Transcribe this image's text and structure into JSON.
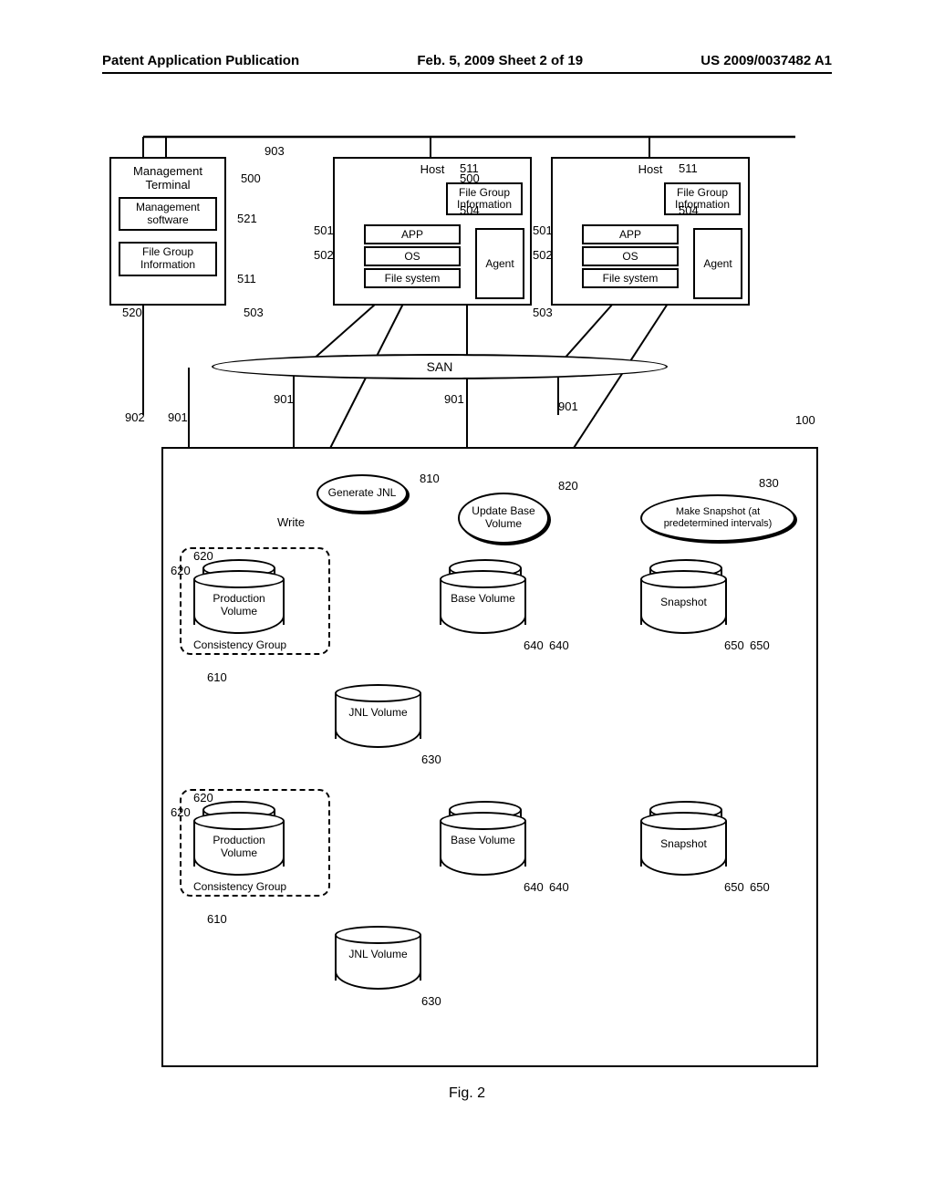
{
  "header": {
    "left": "Patent Application Publication",
    "center": "Feb. 5, 2009  Sheet 2 of 19",
    "right": "US 2009/0037482 A1"
  },
  "mgmt": {
    "title": "Management Terminal",
    "software": "Management software",
    "fginfo": "File Group Information"
  },
  "host": {
    "title": "Host",
    "fginfo": "File Group Information",
    "app": "APP",
    "os": "OS",
    "fs": "File system",
    "agent": "Agent"
  },
  "san": "SAN",
  "ops": {
    "genjnl": "Generate JNL",
    "update": "Update Base Volume",
    "snapshot": "Make Snapshot (at predetermined intervals)",
    "write": "Write"
  },
  "vol": {
    "prod": "Production Volume",
    "base": "Base Volume",
    "snap": "Snapshot",
    "jnl": "JNL Volume",
    "cg": "Consistency Group"
  },
  "refs": {
    "r100": "100",
    "r500a": "500",
    "r500b": "500",
    "r501a": "501",
    "r501b": "501",
    "r502a": "502",
    "r502b": "502",
    "r503a": "503",
    "r503b": "503",
    "r504a": "504",
    "r504b": "504",
    "r511a": "511",
    "r511b": "511",
    "r511c": "511",
    "r520": "520",
    "r521": "521",
    "r610a": "610",
    "r610b": "610",
    "r620a": "620",
    "r620b": "620",
    "r620c": "620",
    "r620d": "620",
    "r630a": "630",
    "r630b": "630",
    "r640a": "640",
    "r640b": "640",
    "r640c": "640",
    "r640d": "640",
    "r650a": "650",
    "r650b": "650",
    "r650c": "650",
    "r650d": "650",
    "r810": "810",
    "r820": "820",
    "r830": "830",
    "r901a": "901",
    "r901b": "901",
    "r901c": "901",
    "r901d": "901",
    "r902": "902",
    "r903": "903"
  },
  "figure": "Fig. 2"
}
